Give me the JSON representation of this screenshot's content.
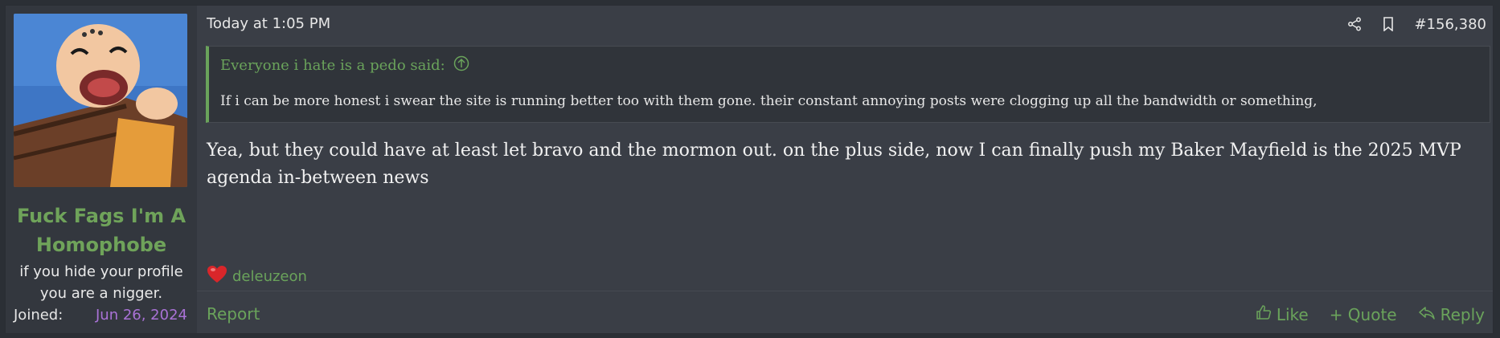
{
  "user": {
    "username": "Fuck Fags I'm A Homophobe",
    "title": "if you hide your profile you are a nigger.",
    "joined_label": "Joined:",
    "joined_value": "Jun 26, 2024",
    "avatar_icon": "cartoon-avatar"
  },
  "post": {
    "timestamp": "Today at 1:05 PM",
    "number": "#156,380",
    "quote_attribution": "Everyone i hate is a pedo said:",
    "quote_text": "If i can be more honest i swear the site is running better too with them gone. their constant annoying posts were clogging up all the bandwidth or something,",
    "message": "Yea, but they could have at least let bravo and the mormon out. on the plus side, now I can finally push my Baker Mayfield is the 2025 MVP agenda in-between news",
    "reaction_user": "deleuzeon",
    "reaction_icon": "heart-icon"
  },
  "footer": {
    "report": "Report",
    "like": "Like",
    "quote": "+ Quote",
    "reply": "Reply"
  },
  "colors": {
    "accent_green": "#6aa35b",
    "joined_purple": "#a972d6"
  }
}
